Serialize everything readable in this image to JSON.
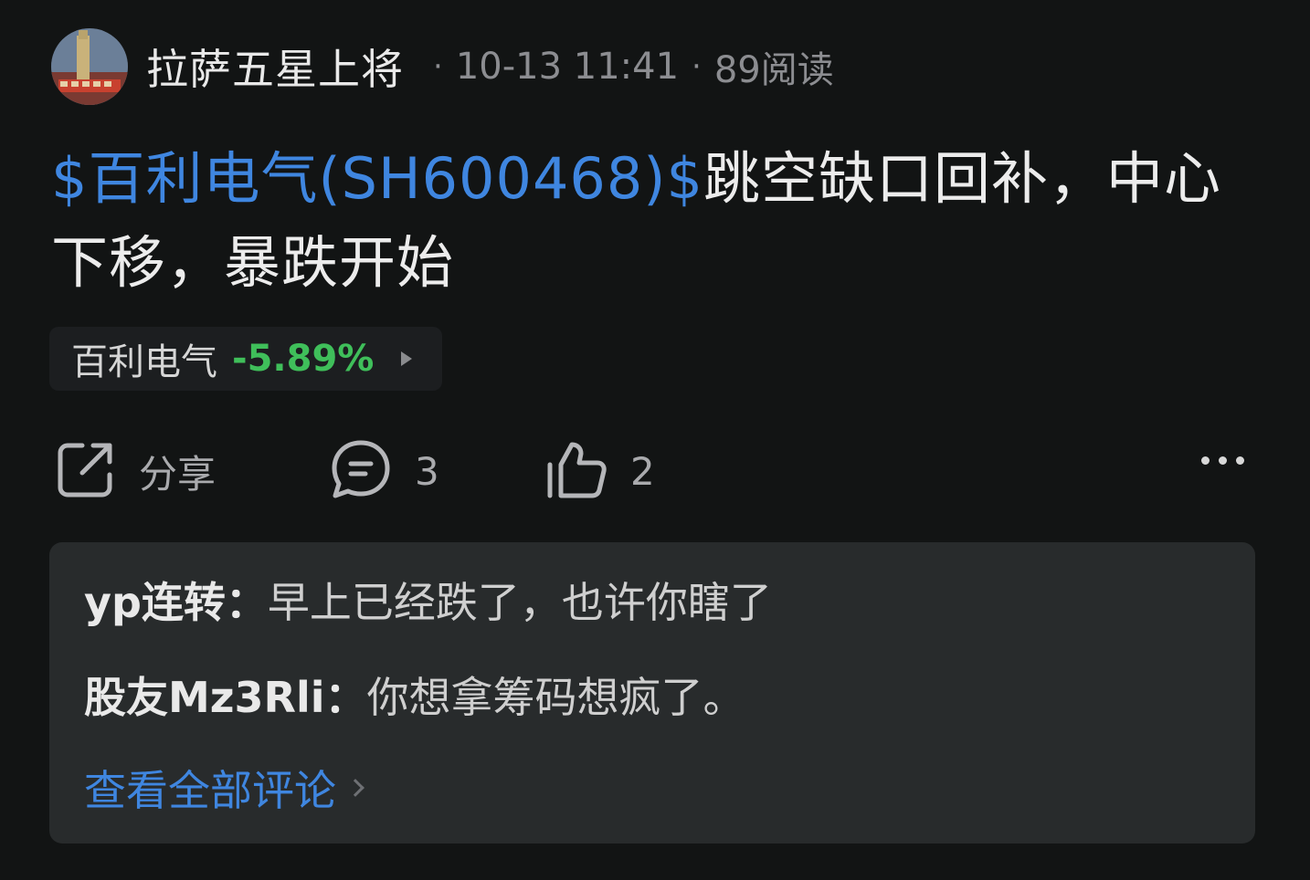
{
  "post": {
    "author": "拉萨五星上将",
    "time": "10-13 11:41",
    "reads": "89阅读",
    "stock_tag": "$百利电气(SH600468)$",
    "text": "跳空缺口回补，中心下移，暴跌开始"
  },
  "stock_chip": {
    "name": "百利电气",
    "change": "-5.89%",
    "change_color": "#3fbf5a"
  },
  "actions": {
    "share_label": "分享",
    "comment_count": "3",
    "like_count": "2"
  },
  "comments": {
    "items": [
      {
        "user": "yp连转：",
        "text": "早上已经跌了，也许你瞎了"
      },
      {
        "user": "股友Mz3Rli：",
        "text": "你想拿筹码想疯了。"
      }
    ],
    "view_all": "查看全部评论"
  },
  "colors": {
    "link": "#3f86e0",
    "background": "#121414",
    "panel": "#282b2c"
  }
}
